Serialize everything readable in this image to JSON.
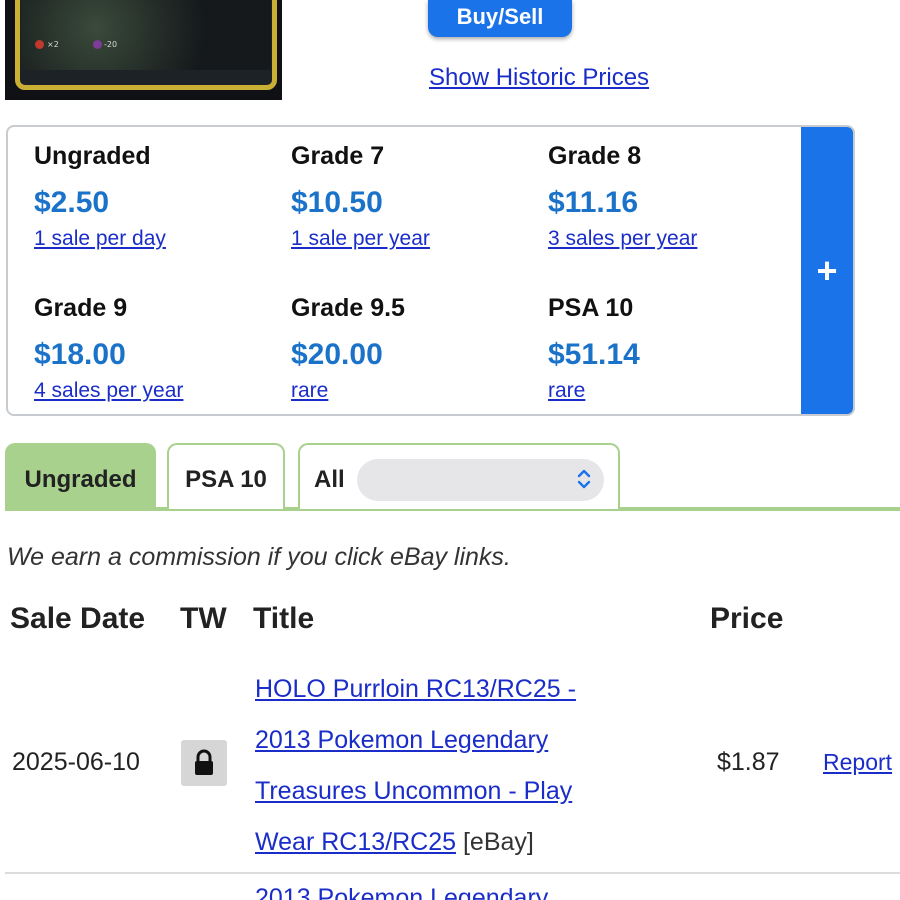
{
  "header": {
    "buy_sell_label": "Buy/Sell",
    "historic_link": "Show Historic Prices"
  },
  "grades": [
    {
      "label": "Ungraded",
      "price": "$2.50",
      "volume": "1 sale per day"
    },
    {
      "label": "Grade 7",
      "price": "$10.50",
      "volume": "1 sale per year"
    },
    {
      "label": "Grade 8",
      "price": "$11.16",
      "volume": "3 sales per year"
    },
    {
      "label": "Grade 9",
      "price": "$18.00",
      "volume": "4 sales per year"
    },
    {
      "label": "Grade 9.5",
      "price": "$20.00",
      "volume": "rare"
    },
    {
      "label": "PSA 10",
      "price": "$51.14",
      "volume": "rare"
    }
  ],
  "expand_symbol": "+",
  "tabs": [
    {
      "label": "Ungraded",
      "active": true
    },
    {
      "label": "PSA 10",
      "active": false
    },
    {
      "label": "All",
      "active": false
    }
  ],
  "select": {
    "value": ""
  },
  "commission_note": "We earn a commission if you click eBay links.",
  "table": {
    "headers": [
      "Sale Date",
      "TW",
      "Title",
      "Price"
    ],
    "rows": [
      {
        "date": "2025-06-10",
        "tw_icon": "lock-icon",
        "title": "HOLO Purrloin RC13/RC25 - 2013 Pokemon Legendary Treasures Uncommon - Play Wear RC13/RC25",
        "title_lines": [
          "HOLO Purrloin RC13/RC25 -",
          "2013 Pokemon Legendary",
          "Treasures Uncommon - Play",
          "Wear RC13/RC25"
        ],
        "source": "[eBay]",
        "price": "$1.87",
        "report": "Report"
      }
    ],
    "next_title_partial": "2013 Pokemon Legendary"
  },
  "card_image": {
    "attack_left": "×2",
    "attack_right": "-20"
  },
  "colors": {
    "accent_blue": "#1a73e8",
    "price_blue": "#1a73c8",
    "link_blue": "#1a2dc9",
    "tab_green": "#a9d18e"
  }
}
